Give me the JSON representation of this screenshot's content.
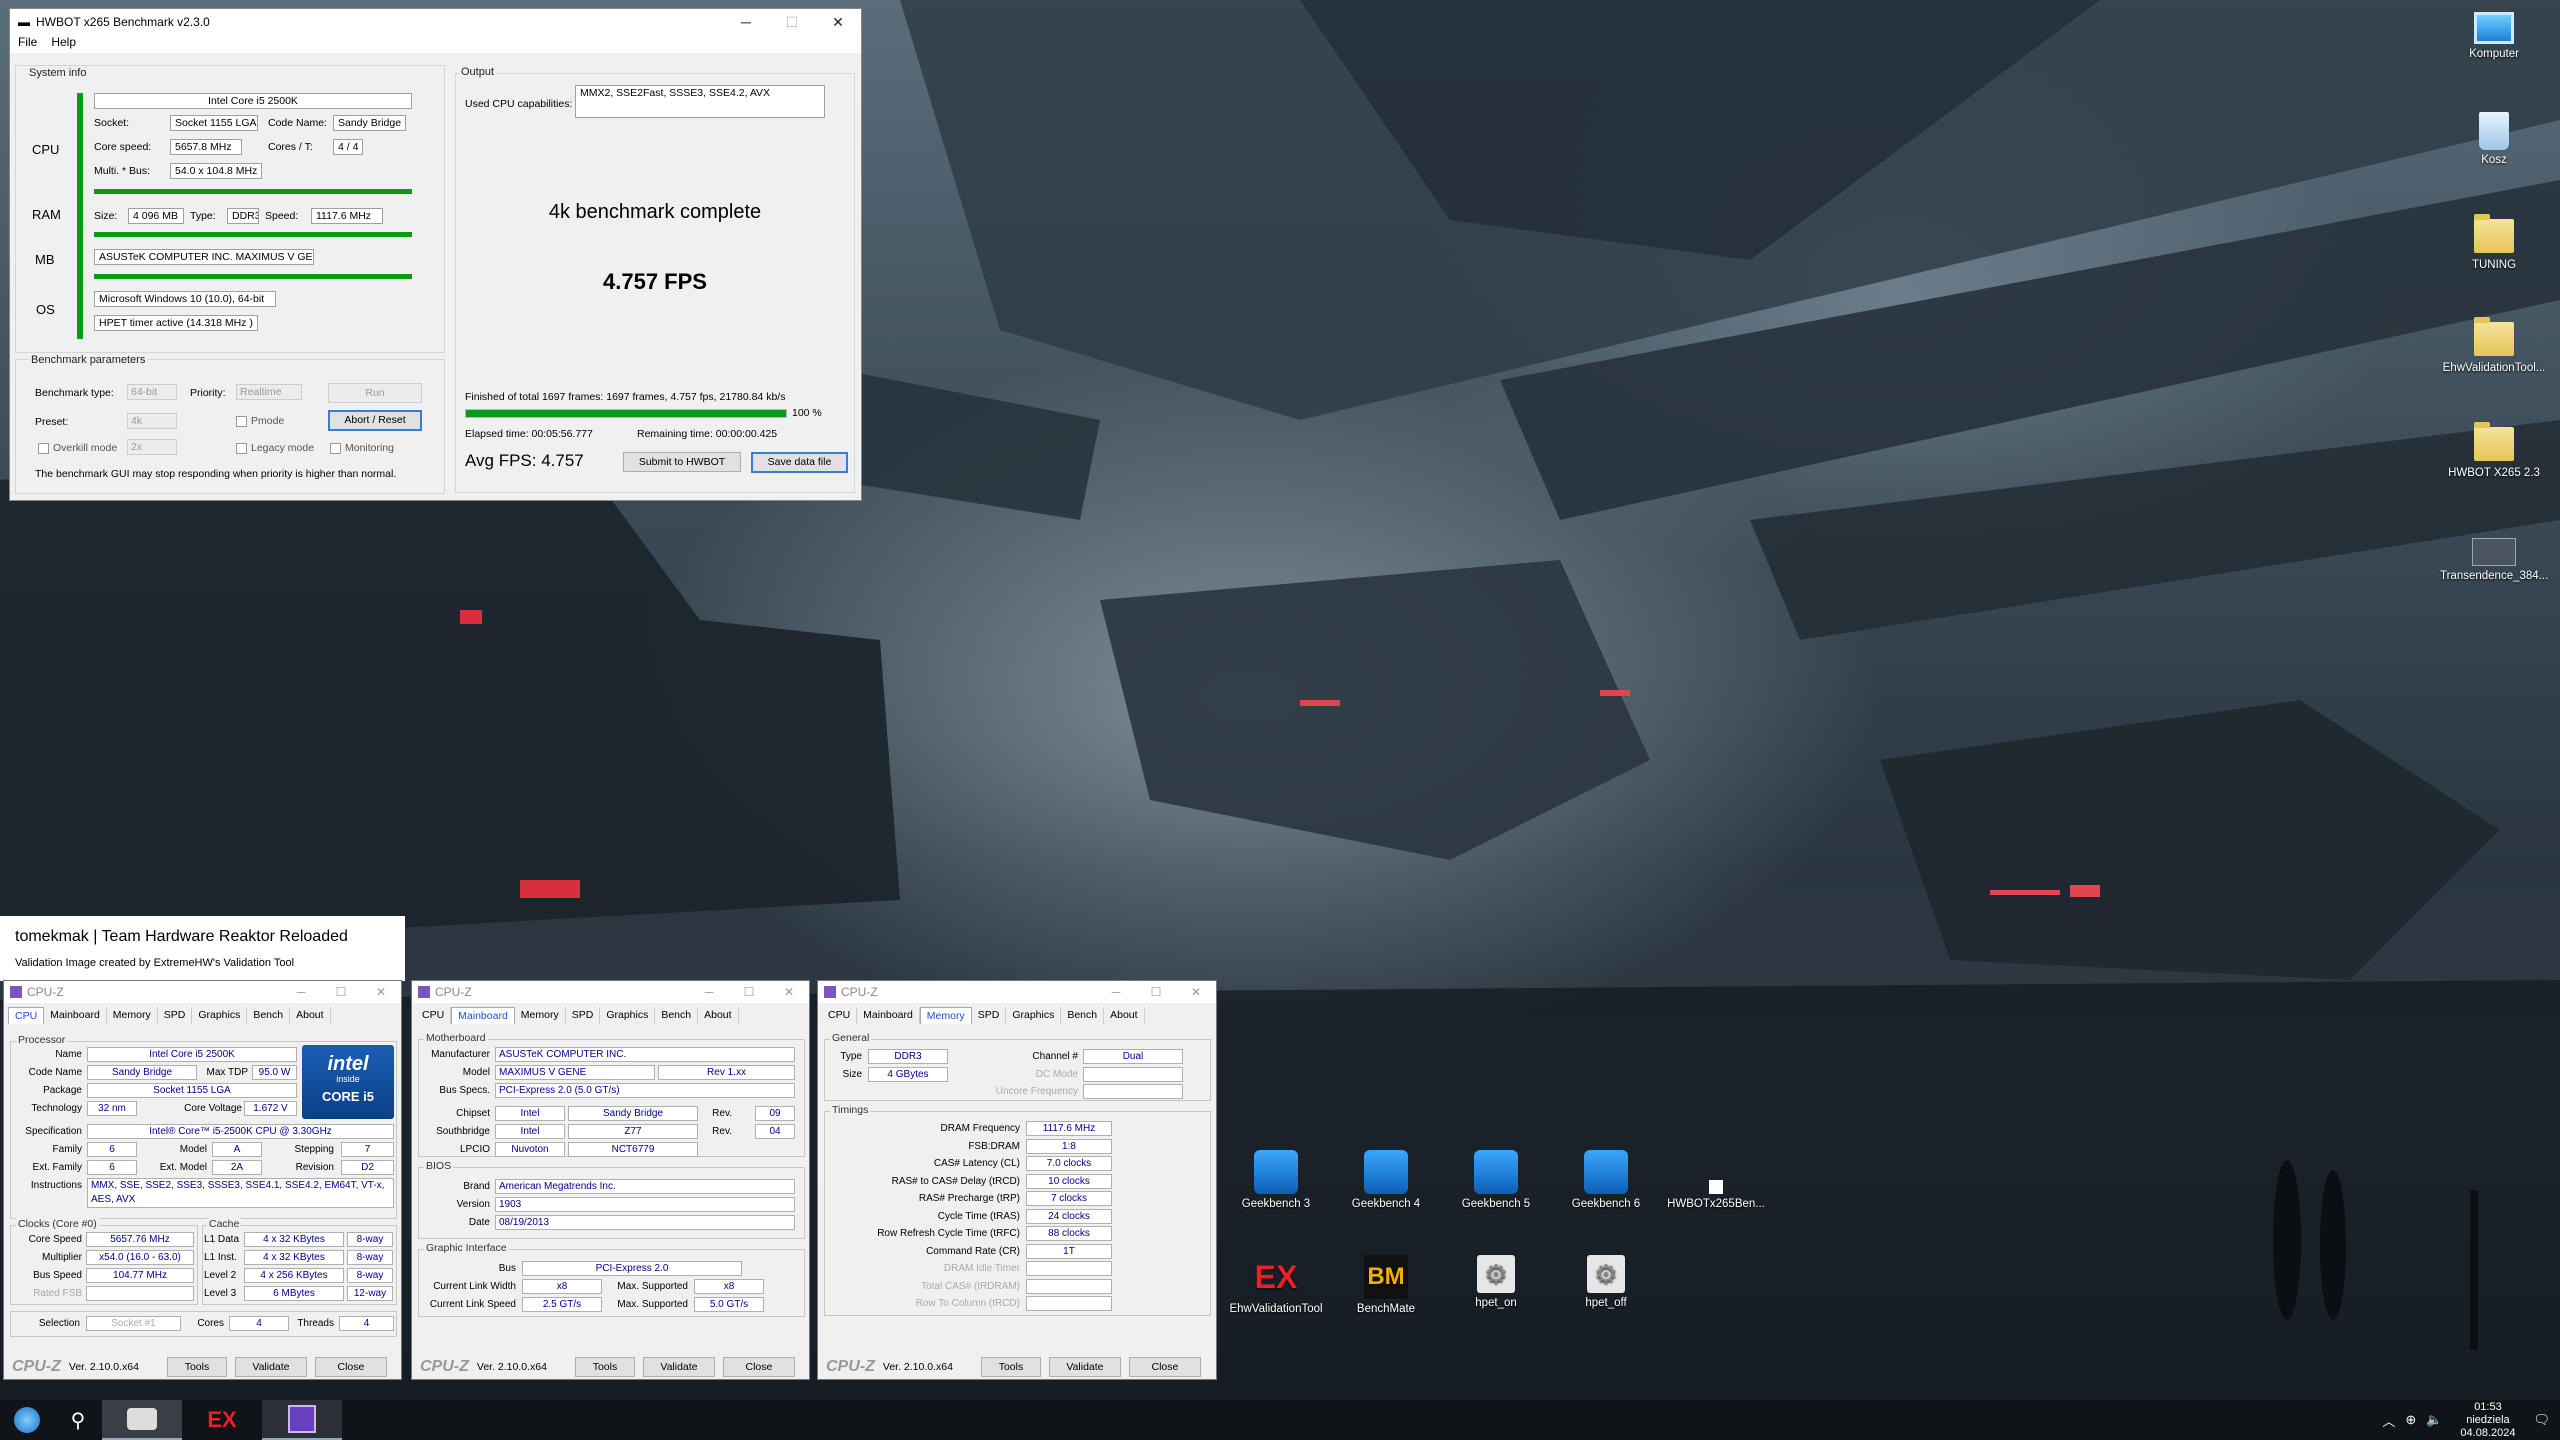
{
  "hwbot": {
    "title": "HWBOT x265 Benchmark v2.3.0",
    "menu": [
      "File",
      "Help"
    ],
    "system_info": "System info",
    "cpu_label": "CPU",
    "ram_label": "RAM",
    "mb_label": "MB",
    "os_label": "OS",
    "cpu_name": "Intel Core i5 2500K",
    "socket_label": "Socket:",
    "socket": "Socket 1155 LGA",
    "codename_label": "Code Name:",
    "codename": "Sandy Bridge",
    "corespeed_label": "Core speed:",
    "corespeed": "5657.8 MHz",
    "cores_label": "Cores / T:",
    "cores": "4 / 4",
    "multi_label": "Multi. * Bus:",
    "multi": "54.0 x 104.8 MHz",
    "ram_size_label": "Size:",
    "ram_size": "4 096 MB",
    "ram_type_label": "Type:",
    "ram_type": "DDR3",
    "ram_speed_label": "Speed:",
    "ram_speed": "1117.6 MHz",
    "mb": "ASUSTeK COMPUTER INC. MAXIMUS V GENE",
    "os": "Microsoft Windows 10 (10.0), 64-bit",
    "timer": "HPET timer active (14.318 MHz )",
    "bench_params": "Benchmark parameters",
    "btype_label": "Benchmark type:",
    "btype": "64-bit",
    "priority_label": "Priority:",
    "priority": "Realtime",
    "run": "Run",
    "preset_label": "Preset:",
    "preset": "4k",
    "pmode": "Pmode",
    "abort": "Abort / Reset",
    "overkill": "Overkill mode",
    "overkill_val": "2x",
    "legacy": "Legacy mode",
    "monitoring": "Monitoring",
    "warning": "The benchmark GUI may stop responding when priority is higher than normal.",
    "output": "Output",
    "capab_label": "Used CPU capabilities:",
    "capab": "MMX2, SSE2Fast, SSSE3, SSE4.2, AVX",
    "complete": "4k benchmark complete",
    "fps": "4.757 FPS",
    "finished": "Finished of total 1697 frames: 1697 frames, 4.757 fps,   21780.84 kb/s",
    "progress_pct": "100 %",
    "progress": 1.0,
    "elapsed": "Elapsed time: 00:05:56.777",
    "remaining": "Remaining time: 00:00:00.425",
    "avg": "Avg FPS: 4.757",
    "submit": "Submit to HWBOT",
    "save": "Save data file"
  },
  "validation": {
    "line1": "tomekmak | Team Hardware Reaktor Reloaded",
    "line2": "Validation Image created by ExtremeHW's Validation Tool"
  },
  "cpuz_common": {
    "title": "CPU-Z",
    "tabs": [
      "CPU",
      "Mainboard",
      "Memory",
      "SPD",
      "Graphics",
      "Bench",
      "About"
    ],
    "logo": "CPU-Z",
    "ver": "Ver. 2.10.0.x64",
    "tools": "Tools",
    "validate": "Validate",
    "close": "Close"
  },
  "cpuz1": {
    "processor": "Processor",
    "name_l": "Name",
    "name": "Intel Core i5 2500K",
    "code_l": "Code Name",
    "code": "Sandy Bridge",
    "tdp_l": "Max TDP",
    "tdp": "95.0 W",
    "pkg_l": "Package",
    "pkg": "Socket 1155 LGA",
    "tech_l": "Technology",
    "tech": "32 nm",
    "volt_l": "Core Voltage",
    "volt": "1.672 V",
    "spec_l": "Specification",
    "spec": "Intel® Core™ i5-2500K CPU @ 3.30GHz",
    "fam_l": "Family",
    "fam": "6",
    "model_l": "Model",
    "model": "A",
    "step_l": "Stepping",
    "step": "7",
    "efam_l": "Ext. Family",
    "efam": "6",
    "emodel_l": "Ext. Model",
    "emodel": "2A",
    "rev_l": "Revision",
    "rev": "D2",
    "instr_l": "Instructions",
    "instr": "MMX, SSE, SSE2, SSE3, SSSE3, SSE4.1, SSE4.2, EM64T, VT-x, AES, AVX",
    "clocks": "Clocks (Core #0)",
    "cs_l": "Core Speed",
    "cs": "5657.76 MHz",
    "mul_l": "Multiplier",
    "mul": "x54.0 (16.0 - 63.0)",
    "bus_l": "Bus Speed",
    "bus": "104.77 MHz",
    "fsb_l": "Rated FSB",
    "cache": "Cache",
    "l1d_l": "L1 Data",
    "l1d": "4 x 32 KBytes",
    "l1d_w": "8-way",
    "l1i_l": "L1 Inst.",
    "l1i": "4 x 32 KBytes",
    "l1i_w": "8-way",
    "l2_l": "Level 2",
    "l2": "4 x 256 KBytes",
    "l2_w": "8-way",
    "l3_l": "Level 3",
    "l3": "6 MBytes",
    "l3_w": "12-way",
    "sel_l": "Selection",
    "sel": "Socket #1",
    "cores_l": "Cores",
    "cores": "4",
    "thr_l": "Threads",
    "thr": "4",
    "badge_brand": "intel",
    "badge_inside": "inside",
    "badge_line": "CORE i5"
  },
  "cpuz2": {
    "motherboard": "Motherboard",
    "man_l": "Manufacturer",
    "man": "ASUSTeK COMPUTER INC.",
    "mod_l": "Model",
    "mod": "MAXIMUS V GENE",
    "rev": "Rev 1.xx",
    "bus_l": "Bus Specs.",
    "bus": "PCI-Express 2.0 (5.0 GT/s)",
    "chip_l": "Chipset",
    "chip": "Intel",
    "chip2": "Sandy Bridge",
    "crev_l": "Rev.",
    "crev": "09",
    "sb_l": "Southbridge",
    "sb": "Intel",
    "sb2": "Z77",
    "srev": "04",
    "lpc_l": "LPCIO",
    "lpc": "Nuvoton",
    "lpc2": "NCT6779",
    "bios": "BIOS",
    "brand_l": "Brand",
    "brand": "American Megatrends Inc.",
    "ver_l": "Version",
    "ver": "1903",
    "date_l": "Date",
    "date": "08/19/2013",
    "gi": "Graphic Interface",
    "gbus_l": "Bus",
    "gbus": "PCI-Express 2.0",
    "clw_l": "Current Link Width",
    "clw": "x8",
    "msw_l": "Max. Supported",
    "msw": "x8",
    "cls_l": "Current Link Speed",
    "cls": "2.5 GT/s",
    "mss_l": "Max. Supported",
    "mss": "5.0 GT/s"
  },
  "cpuz3": {
    "general": "General",
    "type_l": "Type",
    "type": "DDR3",
    "ch_l": "Channel #",
    "ch": "Dual",
    "size_l": "Size",
    "size": "4 GBytes",
    "dc_l": "DC Mode",
    "uf_l": "Uncore Frequency",
    "timings": "Timings",
    "rows": [
      [
        "DRAM Frequency",
        "1117.6 MHz"
      ],
      [
        "FSB:DRAM",
        "1:8"
      ],
      [
        "CAS# Latency (CL)",
        "7.0 clocks"
      ],
      [
        "RAS# to CAS# Delay (tRCD)",
        "10 clocks"
      ],
      [
        "RAS# Precharge (tRP)",
        "7 clocks"
      ],
      [
        "Cycle Time (tRAS)",
        "24 clocks"
      ],
      [
        "Row Refresh Cycle Time (tRFC)",
        "88 clocks"
      ],
      [
        "Command Rate (CR)",
        "1T"
      ],
      [
        "DRAM Idle Timer",
        ""
      ],
      [
        "Total CAS# (tRDRAM)",
        ""
      ],
      [
        "Row To Column (tRCD)",
        ""
      ]
    ]
  },
  "desktop": {
    "icons_right": [
      "Komputer",
      "Kosz",
      "TUNING",
      "EhwValidationTool...",
      "HWBOT X265 2.3",
      "Transendence_384..."
    ],
    "icons_grid": [
      "Geekbench 3",
      "Geekbench 4",
      "Geekbench 5",
      "Geekbench 6",
      "HWBOTx265Ben...",
      "EhwValidationTool",
      "BenchMate",
      "hpet_on",
      "hpet_off"
    ]
  },
  "taskbar": {
    "time": "01:53",
    "day": "niedziela",
    "date": "04.08.2024"
  }
}
